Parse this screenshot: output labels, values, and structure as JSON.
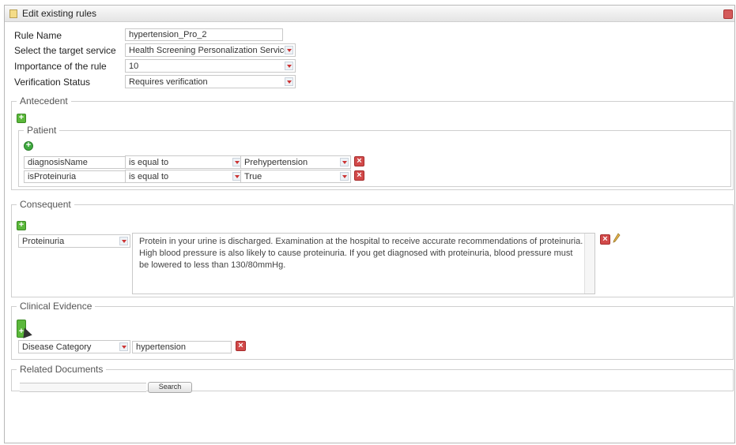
{
  "window": {
    "title": "Edit existing rules"
  },
  "form": {
    "rule_name_label": "Rule Name",
    "rule_name_value": "hypertension_Pro_2",
    "target_service_label": "Select the target service",
    "target_service_value": "Health Screening Personalization Service",
    "importance_label": "Importance of the rule",
    "importance_value": "10",
    "verification_label": "Verification Status",
    "verification_value": "Requires verification"
  },
  "antecedent": {
    "legend": "Antecedent",
    "patient": {
      "legend": "Patient",
      "conditions": [
        {
          "field": "diagnosisName",
          "operator": "is equal to",
          "value": "Prehypertension"
        },
        {
          "field": "isProteinuria",
          "operator": "is equal to",
          "value": "True"
        }
      ]
    }
  },
  "consequent": {
    "legend": "Consequent",
    "category": "Proteinuria",
    "text": "Protein in your urine is discharged. Examination at the hospital to receive accurate recommendations of proteinuria. High blood pressure is also likely to cause proteinuria. If you get diagnosed with proteinuria, blood pressure must be lowered to less than 130/80mmHg."
  },
  "clinical_evidence": {
    "legend": "Clinical Evidence",
    "category": "Disease Category",
    "value": "hypertension"
  },
  "related_documents": {
    "legend": "Related Documents",
    "search_label": "Search"
  },
  "icons": {
    "add": "plus-icon",
    "delete": "delete-icon",
    "edit": "pencil-icon",
    "dropdown": "chevron-down-icon"
  }
}
